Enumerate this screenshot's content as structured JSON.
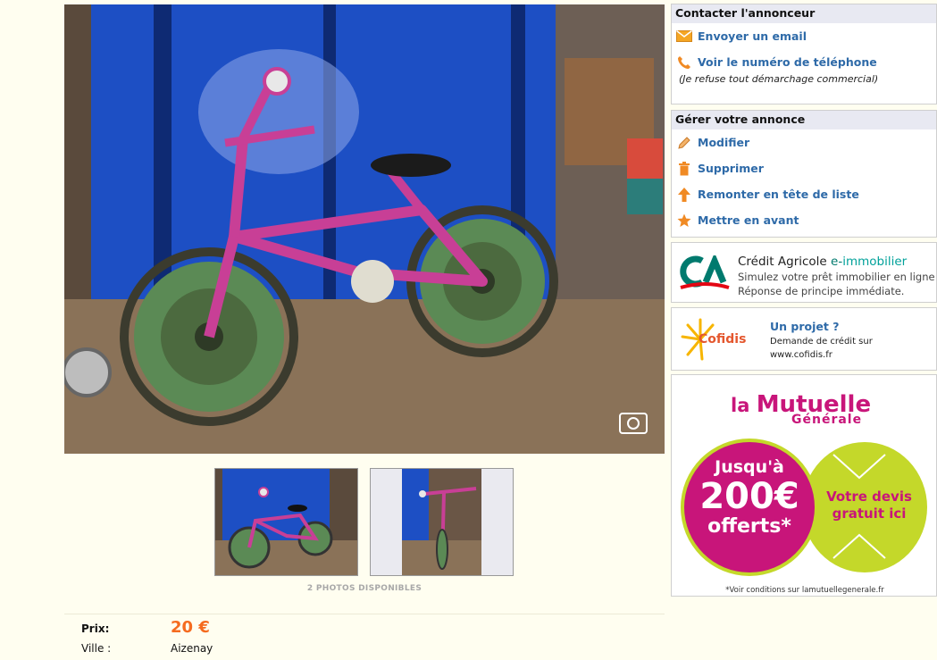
{
  "contact": {
    "title": "Contacter l'annonceur",
    "email": "Envoyer un email",
    "phone": "Voir le numéro de téléphone",
    "note": "(Je refuse tout démarchage commercial)"
  },
  "manage": {
    "title": "Gérer votre annonce",
    "items": [
      "Modifier",
      "Supprimer",
      "Remonter en tête de liste",
      "Mettre en avant"
    ]
  },
  "photos": {
    "count_label": "2 PHOTOS DISPONIBLES"
  },
  "details": {
    "price_label": "Prix:",
    "price_value": "20 €",
    "city_label": "Ville :",
    "city_value": "Aizenay"
  },
  "ads": {
    "ca": {
      "brand": "Crédit Agricole",
      "brand_e": "e-",
      "brand_suffix": "immobilier",
      "line1": "Simulez votre prêt immobilier en ligne",
      "line2": "Réponse de principe immédiate."
    },
    "cofidis": {
      "logo": "Cofidis",
      "title": "Un projet ?",
      "line1": "Demande de crédit sur",
      "line2": "www.cofidis.fr"
    },
    "mutuelle": {
      "logo_la": "la",
      "logo_name": "Mutuelle",
      "logo_sub": "Générale",
      "offer_1": "Jusqu'à",
      "offer_2": "200€",
      "offer_3": "offerts*",
      "cta_1": "Votre devis",
      "cta_2": "gratuit ici",
      "footnote": "*Voir conditions sur lamutuellegenerale.fr"
    }
  },
  "colors": {
    "link": "#2e6aa8",
    "price": "#f56b1f",
    "box_header": "#e8e9f2",
    "mutuelle_magenta": "#c8157a",
    "mutuelle_lime": "#c4d82a"
  }
}
